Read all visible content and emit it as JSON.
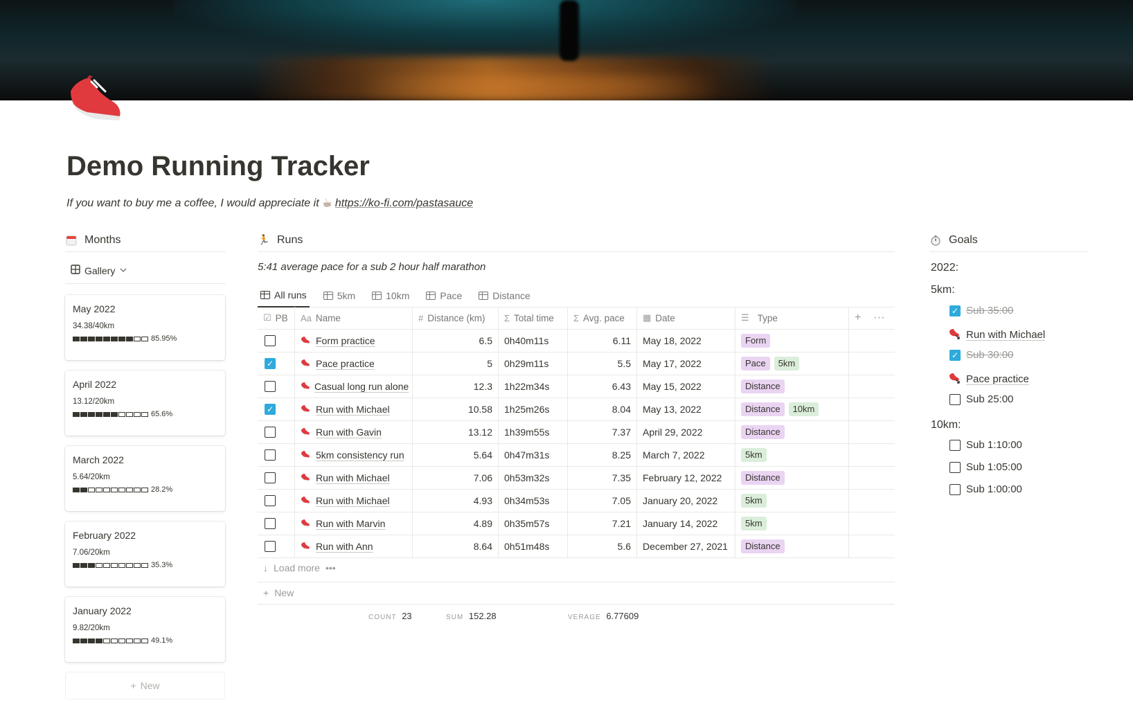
{
  "page": {
    "title": "Demo Running Tracker",
    "subtitle_text": "If you want to buy me a coffee, I would appreciate it",
    "subtitle_cup": "☕",
    "subtitle_link": "https://ko-fi.com/pastasauce"
  },
  "months": {
    "header": "Months",
    "view_label": "Gallery",
    "new_label": "New",
    "cards": [
      {
        "month": "May 2022",
        "value": "34.38/40km",
        "percent_label": "85.95%",
        "filled": 8
      },
      {
        "month": "April 2022",
        "value": "13.12/20km",
        "percent_label": "65.6%",
        "filled": 6
      },
      {
        "month": "March 2022",
        "value": "5.64/20km",
        "percent_label": "28.2%",
        "filled": 2
      },
      {
        "month": "February 2022",
        "value": "7.06/20km",
        "percent_label": "35.3%",
        "filled": 3
      },
      {
        "month": "January 2022",
        "value": "9.82/20km",
        "percent_label": "49.1%",
        "filled": 4
      }
    ],
    "bar_segments": 10
  },
  "runs": {
    "header": "Runs",
    "caption": "5:41 average pace for a sub 2 hour half marathon",
    "views": [
      "All runs",
      "5km",
      "10km",
      "Pace",
      "Distance"
    ],
    "columns": {
      "pb": "PB",
      "name": "Name",
      "distance": "Distance (km)",
      "total_time": "Total time",
      "avg_pace": "Avg. pace",
      "date": "Date",
      "type": "Type"
    },
    "rows": [
      {
        "pb": false,
        "name": "Form practice",
        "distance": "6.5",
        "time": "0h40m11s",
        "pace": "6.11",
        "date": "May 18, 2022",
        "types": [
          "Form"
        ]
      },
      {
        "pb": true,
        "name": "Pace practice",
        "distance": "5",
        "time": "0h29m11s",
        "pace": "5.5",
        "date": "May 17, 2022",
        "types": [
          "Pace",
          "5km"
        ]
      },
      {
        "pb": false,
        "name": "Casual long run alone",
        "distance": "12.3",
        "time": "1h22m34s",
        "pace": "6.43",
        "date": "May 15, 2022",
        "types": [
          "Distance"
        ]
      },
      {
        "pb": true,
        "name": "Run with Michael",
        "distance": "10.58",
        "time": "1h25m26s",
        "pace": "8.04",
        "date": "May 13, 2022",
        "types": [
          "Distance",
          "10km"
        ]
      },
      {
        "pb": false,
        "name": "Run with Gavin",
        "distance": "13.12",
        "time": "1h39m55s",
        "pace": "7.37",
        "date": "April 29, 2022",
        "types": [
          "Distance"
        ]
      },
      {
        "pb": false,
        "name": "5km consistency run",
        "distance": "5.64",
        "time": "0h47m31s",
        "pace": "8.25",
        "date": "March 7, 2022",
        "types": [
          "5km"
        ]
      },
      {
        "pb": false,
        "name": "Run with Michael",
        "distance": "7.06",
        "time": "0h53m32s",
        "pace": "7.35",
        "date": "February 12, 2022",
        "types": [
          "Distance"
        ]
      },
      {
        "pb": false,
        "name": "Run with Michael",
        "distance": "4.93",
        "time": "0h34m53s",
        "pace": "7.05",
        "date": "January 20, 2022",
        "types": [
          "5km"
        ]
      },
      {
        "pb": false,
        "name": "Run with Marvin",
        "distance": "4.89",
        "time": "0h35m57s",
        "pace": "7.21",
        "date": "January 14, 2022",
        "types": [
          "5km"
        ]
      },
      {
        "pb": false,
        "name": "Run with Ann",
        "distance": "8.64",
        "time": "0h51m48s",
        "pace": "5.6",
        "date": "December 27, 2021",
        "types": [
          "Distance"
        ]
      }
    ],
    "type_colors": {
      "Form": "#ead4f2",
      "Pace": "#ead4f2",
      "Distance": "#ead4f2",
      "5km": "#dbeddb",
      "10km": "#dbeddb"
    },
    "load_more": "Load more",
    "new_label": "New",
    "calc": {
      "count_label": "COUNT",
      "count_value": "23",
      "sum_label": "SUM",
      "sum_value": "152.28",
      "avg_label": "VERAGE",
      "avg_value": "6.77609"
    }
  },
  "goals": {
    "header": "Goals",
    "year": "2022:",
    "group_5km": "5km:",
    "group_10km": "10km:",
    "items_5km": [
      {
        "kind": "check",
        "checked": true,
        "label": "Sub 35:00"
      },
      {
        "kind": "link",
        "label": "Run with Michael"
      },
      {
        "kind": "check",
        "checked": true,
        "label": "Sub 30:00"
      },
      {
        "kind": "link",
        "label": "Pace practice"
      },
      {
        "kind": "check",
        "checked": false,
        "label": "Sub 25:00"
      }
    ],
    "items_10km": [
      {
        "kind": "check",
        "checked": false,
        "label": "Sub 1:10:00"
      },
      {
        "kind": "check",
        "checked": false,
        "label": "Sub 1:05:00"
      },
      {
        "kind": "check",
        "checked": false,
        "label": "Sub 1:00:00"
      }
    ]
  },
  "colors": {
    "accent_checkbox": "#2eaadc",
    "shoe_red": "#e03a3e"
  }
}
